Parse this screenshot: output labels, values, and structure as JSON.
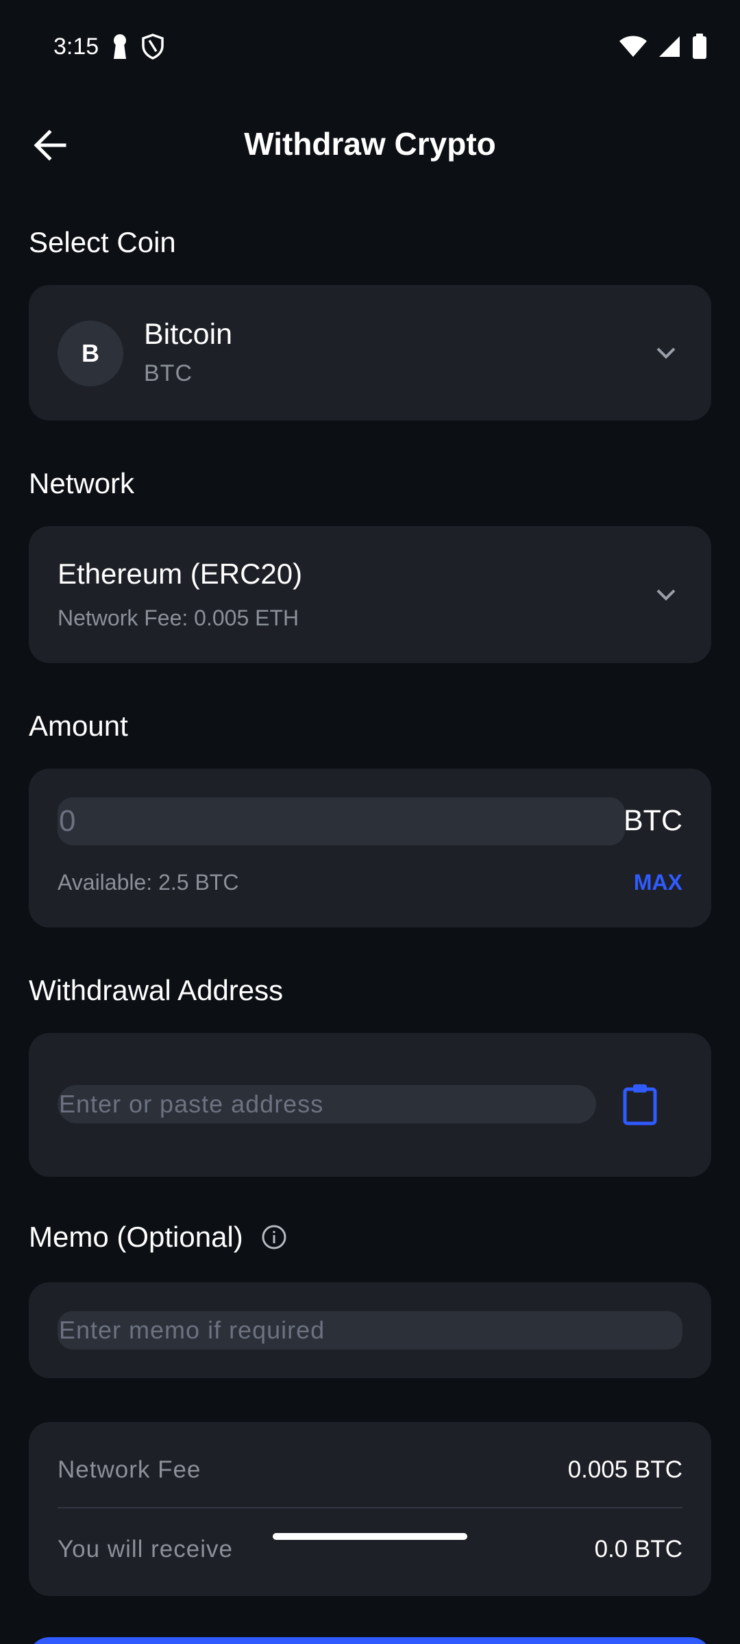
{
  "status_bar": {
    "time": "3:15",
    "left_icons": [
      "keyhole-icon",
      "shield-icon"
    ],
    "right_icons": [
      "wifi-icon",
      "signal-icon",
      "battery-icon"
    ]
  },
  "app_bar": {
    "title": "Withdraw Crypto",
    "back_icon": "arrow-left-icon"
  },
  "coin": {
    "section_label": "Select Coin",
    "avatar_letter": "B",
    "name": "Bitcoin",
    "symbol": "BTC"
  },
  "network": {
    "section_label": "Network",
    "name": "Ethereum (ERC20)",
    "fee_text": "Network Fee: 0.005 ETH"
  },
  "amount": {
    "section_label": "Amount",
    "value": "",
    "placeholder": "0",
    "unit": "BTC",
    "available_text": "Available: 2.5 BTC",
    "max_label": "MAX"
  },
  "address": {
    "section_label": "Withdrawal Address",
    "value": "",
    "placeholder": "Enter or paste address"
  },
  "memo": {
    "section_label": "Memo (Optional)",
    "value": "",
    "placeholder": "Enter memo if required"
  },
  "summary": {
    "fee_label": "Network Fee",
    "fee_value": "0.005 BTC",
    "receive_label": "You will receive",
    "receive_value": "0.0 BTC"
  },
  "colors": {
    "background": "#0c0f14",
    "card": "#1e2027",
    "accent": "#2f5bff",
    "muted_text": "#8b9099"
  }
}
